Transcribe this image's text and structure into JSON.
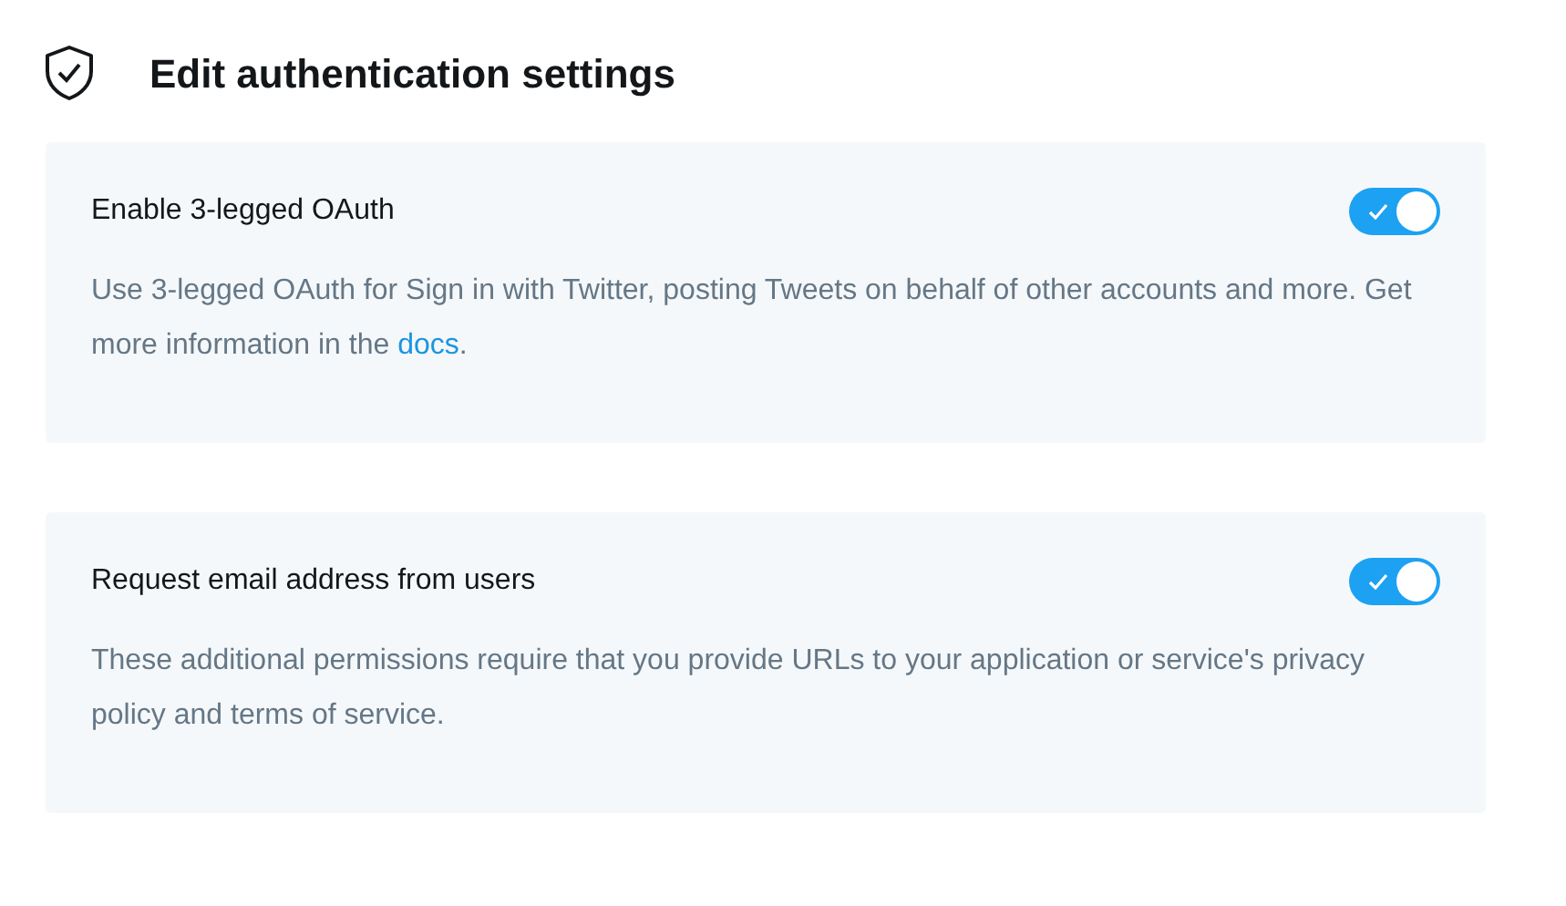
{
  "header": {
    "title": "Edit authentication settings"
  },
  "settings": [
    {
      "title": "Enable 3-legged OAuth",
      "on": true,
      "description": [
        {
          "kind": "text",
          "text": "Use 3-legged OAuth for Sign in with Twitter, posting Tweets on behalf of other accounts and more. Get more information in the "
        },
        {
          "kind": "link",
          "text": "docs"
        },
        {
          "kind": "text",
          "text": "."
        }
      ]
    },
    {
      "title": "Request email address from users",
      "on": true,
      "description": [
        {
          "kind": "text",
          "text": "These additional permissions require that you provide URLs to your application or service's privacy policy and terms of service."
        }
      ]
    }
  ]
}
